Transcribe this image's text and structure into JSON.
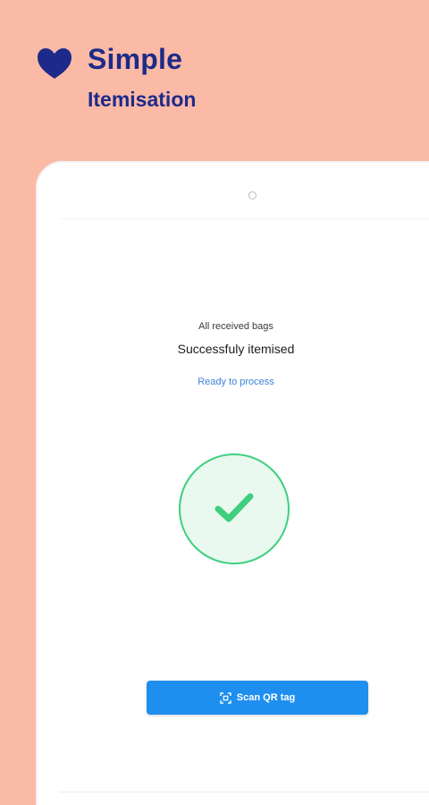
{
  "brand": {
    "title": "Simple",
    "subtitle": "Itemisation",
    "logo_icon": "heart-icon",
    "color": "#1e2a8a"
  },
  "colors": {
    "background": "#fbbaa6",
    "accent": "#1f8fef",
    "success": "#3fcf7f"
  },
  "status": {
    "caption": "All received bags",
    "headline": "Successfuly itemised",
    "link": "Ready to process",
    "icon": "check-icon"
  },
  "actions": {
    "scan_label": "Scan QR tag",
    "scan_icon": "qr-scan-icon"
  }
}
